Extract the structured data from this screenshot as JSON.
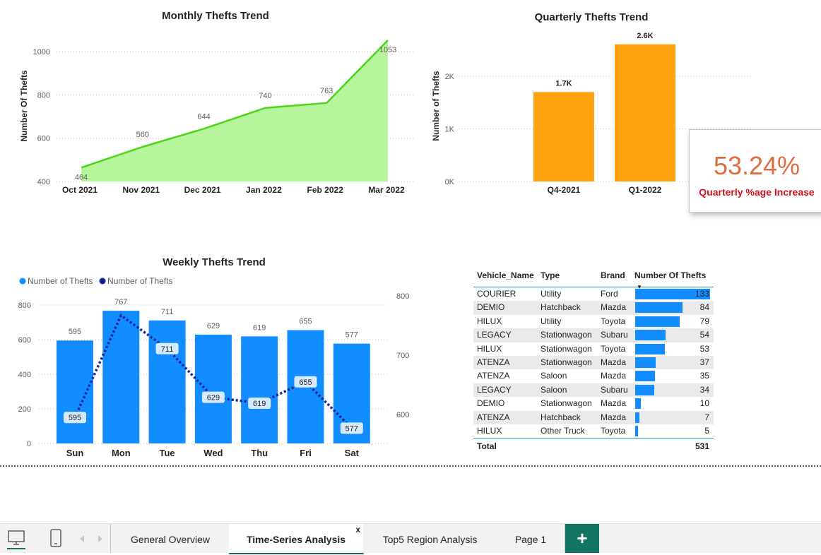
{
  "monthly": {
    "title": "Monthly Thefts Trend",
    "ylabel": "Number Of Thefts",
    "yticks": [
      "400",
      "600",
      "800",
      "1000"
    ]
  },
  "quarterly": {
    "title": "Quarterly Thefts Trend",
    "ylabel": "Number of Thefts",
    "yticks": [
      "0K",
      "1K",
      "2K"
    ],
    "labels": [
      "1.7K",
      "2.6K"
    ]
  },
  "weekly": {
    "title": "Weekly Thefts Trend",
    "legend": [
      "Number of Thefts",
      "Number of Thefts"
    ],
    "yticks_left": [
      "0",
      "200",
      "400",
      "600",
      "800"
    ],
    "yticks_right": [
      "600",
      "700",
      "800"
    ]
  },
  "kpi": {
    "value": "53.24%",
    "label": "Quarterly %age Increase"
  },
  "table": {
    "headers": [
      "Vehicle_Name",
      "Type",
      "Brand",
      "Number Of Thefts"
    ],
    "rows": [
      {
        "name": "COURIER",
        "type": "Utility",
        "brand": "Ford",
        "thefts": 133
      },
      {
        "name": "DEMIO",
        "type": "Hatchback",
        "brand": "Mazda",
        "thefts": 84
      },
      {
        "name": "HILUX",
        "type": "Utility",
        "brand": "Toyota",
        "thefts": 79
      },
      {
        "name": "LEGACY",
        "type": "Stationwagon",
        "brand": "Subaru",
        "thefts": 54
      },
      {
        "name": "HILUX",
        "type": "Stationwagon",
        "brand": "Toyota",
        "thefts": 53
      },
      {
        "name": "ATENZA",
        "type": "Stationwagon",
        "brand": "Mazda",
        "thefts": 37
      },
      {
        "name": "ATENZA",
        "type": "Saloon",
        "brand": "Mazda",
        "thefts": 35
      },
      {
        "name": "LEGACY",
        "type": "Saloon",
        "brand": "Subaru",
        "thefts": 34
      },
      {
        "name": "DEMIO",
        "type": "Stationwagon",
        "brand": "Mazda",
        "thefts": 10
      },
      {
        "name": "ATENZA",
        "type": "Hatchback",
        "brand": "Mazda",
        "thefts": 7
      },
      {
        "name": "HILUX",
        "type": "Other Truck",
        "brand": "Toyota",
        "thefts": 5
      }
    ],
    "total_label": "Total",
    "total_value": "531",
    "sort_indicator": "▼"
  },
  "tabs": [
    "General Overview",
    "Time-Series Analysis",
    "Top5 Region Analysis",
    "Page 1"
  ],
  "tab_close": "x",
  "add_page": "+",
  "colors": {
    "area_fill": "#b6f59b",
    "area_line": "#4cd41a",
    "quarter_bar": "#ffa40e",
    "week_bar": "#118dff",
    "week_line": "#12239e",
    "kpi": "#e06c3c"
  },
  "chart_data": [
    {
      "type": "area",
      "title": "Monthly Thefts Trend",
      "ylabel": "Number Of Thefts",
      "categories": [
        "Oct 2021",
        "Nov 2021",
        "Dec 2021",
        "Jan 2022",
        "Feb 2022",
        "Mar 2022"
      ],
      "values": [
        464,
        560,
        644,
        740,
        763,
        1053
      ],
      "ylim": [
        400,
        1050
      ]
    },
    {
      "type": "bar",
      "title": "Quarterly Thefts Trend",
      "ylabel": "Number of Thefts",
      "categories": [
        "Q4-2021",
        "Q1-2022"
      ],
      "values": [
        1700,
        2600
      ],
      "ylim": [
        0,
        2600
      ]
    },
    {
      "type": "bar",
      "title": "Weekly Thefts Trend",
      "categories": [
        "Sun",
        "Mon",
        "Tue",
        "Wed",
        "Thu",
        "Fri",
        "Sat"
      ],
      "series": [
        {
          "name": "Number of Thefts",
          "type": "bar",
          "values": [
            595,
            767,
            711,
            629,
            619,
            655,
            577
          ]
        },
        {
          "name": "Number of Thefts",
          "type": "line",
          "axis": "right",
          "values": [
            595,
            767,
            711,
            629,
            619,
            655,
            577
          ]
        }
      ],
      "ylim_left": [
        0,
        800
      ],
      "ylim_right": [
        570,
        800
      ]
    }
  ]
}
